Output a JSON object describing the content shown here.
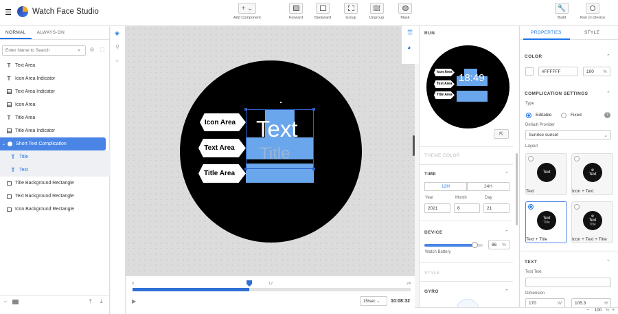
{
  "app": {
    "title": "Watch Face Studio"
  },
  "toolbar": {
    "add_component": "Add Component",
    "forward": "Forward",
    "backward": "Backward",
    "group": "Group",
    "ungroup": "Ungroup",
    "mask": "Mask",
    "build": "Build",
    "run_on_device": "Run on Device"
  },
  "left_panel": {
    "tabs": [
      "NORMAL",
      "ALWAYS-ON"
    ],
    "active_tab": "NORMAL",
    "search_placeholder": "Enter Name to Search",
    "layers": [
      {
        "label": "Text Area",
        "icon": "text-icon"
      },
      {
        "label": "Icon Area Indicator",
        "icon": "text-icon"
      },
      {
        "label": "Text Area Indicator",
        "icon": "image-icon"
      },
      {
        "label": "Icon Area",
        "icon": "image-icon"
      },
      {
        "label": "Title Area",
        "icon": "text-icon"
      },
      {
        "label": "Title Area Indicator",
        "icon": "image-icon"
      },
      {
        "label": "Short Text Complication",
        "icon": "complication-icon"
      },
      {
        "label": "Title",
        "icon": "text-icon"
      },
      {
        "label": "Text",
        "icon": "text-icon"
      },
      {
        "label": "Title Background Rectangle",
        "icon": "rectangle-icon"
      },
      {
        "label": "Text Background Rectangle",
        "icon": "rectangle-icon"
      },
      {
        "label": "Icon Background  Rectangle",
        "icon": "rectangle-icon"
      }
    ]
  },
  "canvas": {
    "labels": [
      "Icon Area",
      "Text Area",
      "Title Area"
    ],
    "text_preview": "Text",
    "title_preview": "Title"
  },
  "timeline": {
    "ticks": [
      "0",
      "12",
      "24"
    ],
    "position_fraction": 0.42,
    "speed": "15/sec",
    "time": "10:08:32"
  },
  "run_panel": {
    "title": "RUN",
    "preview_time": "18:49",
    "preview_labels": [
      "Icon Area",
      "Text Area",
      "Title Area"
    ],
    "theme_color": "THEME COLOR",
    "time_section": "TIME",
    "hour_modes": [
      "12H",
      "24H"
    ],
    "active_hour_mode": "12H",
    "date_labels": [
      "Year",
      "Month",
      "Day"
    ],
    "date_values": [
      "2021",
      "6",
      "21"
    ],
    "device_section": "DEVICE",
    "battery_value": "86",
    "battery_unit": "%",
    "battery_fraction": 0.86,
    "watch_battery": "Watch Battery",
    "style_section": "STYLE",
    "gyro_section": "GYRO"
  },
  "props_panel": {
    "tabs": [
      "PROPERTIES",
      "STYLE"
    ],
    "active_tab": "PROPERTIES",
    "color_section": "COLOR",
    "color_hex": "#FFFFFF",
    "opacity": "100",
    "opacity_unit": "%",
    "complication_section": "COMPLICATION SETTINGS",
    "type_label": "Type",
    "type_options": [
      "Editable",
      "Fixed"
    ],
    "selected_type": "Editable",
    "default_provider_label": "Default Provider",
    "default_provider": "Sunrise sunset",
    "layout_label": "Layout",
    "layouts": [
      {
        "caption": "Text",
        "lines": [
          "Text"
        ]
      },
      {
        "caption": "Icon + Text",
        "lines": [
          "Text"
        ]
      },
      {
        "caption": "Text + Title",
        "lines": [
          "Text",
          "Title"
        ]
      },
      {
        "caption": "Icon + Text + Title",
        "lines": [
          "Text",
          "Title"
        ]
      }
    ],
    "selected_layout": "Text + Title",
    "text_section": "TEXT",
    "text_text_label": "Test Text",
    "text_text_value": "",
    "dimension_label": "Dimension",
    "width": "170",
    "width_unit": "W",
    "height": "105.3",
    "height_unit": "H",
    "zoom": "100"
  },
  "colors": {
    "accent": "#1a73e8",
    "selection": "#4a85e6",
    "area_fill": "#6aa6ec"
  }
}
